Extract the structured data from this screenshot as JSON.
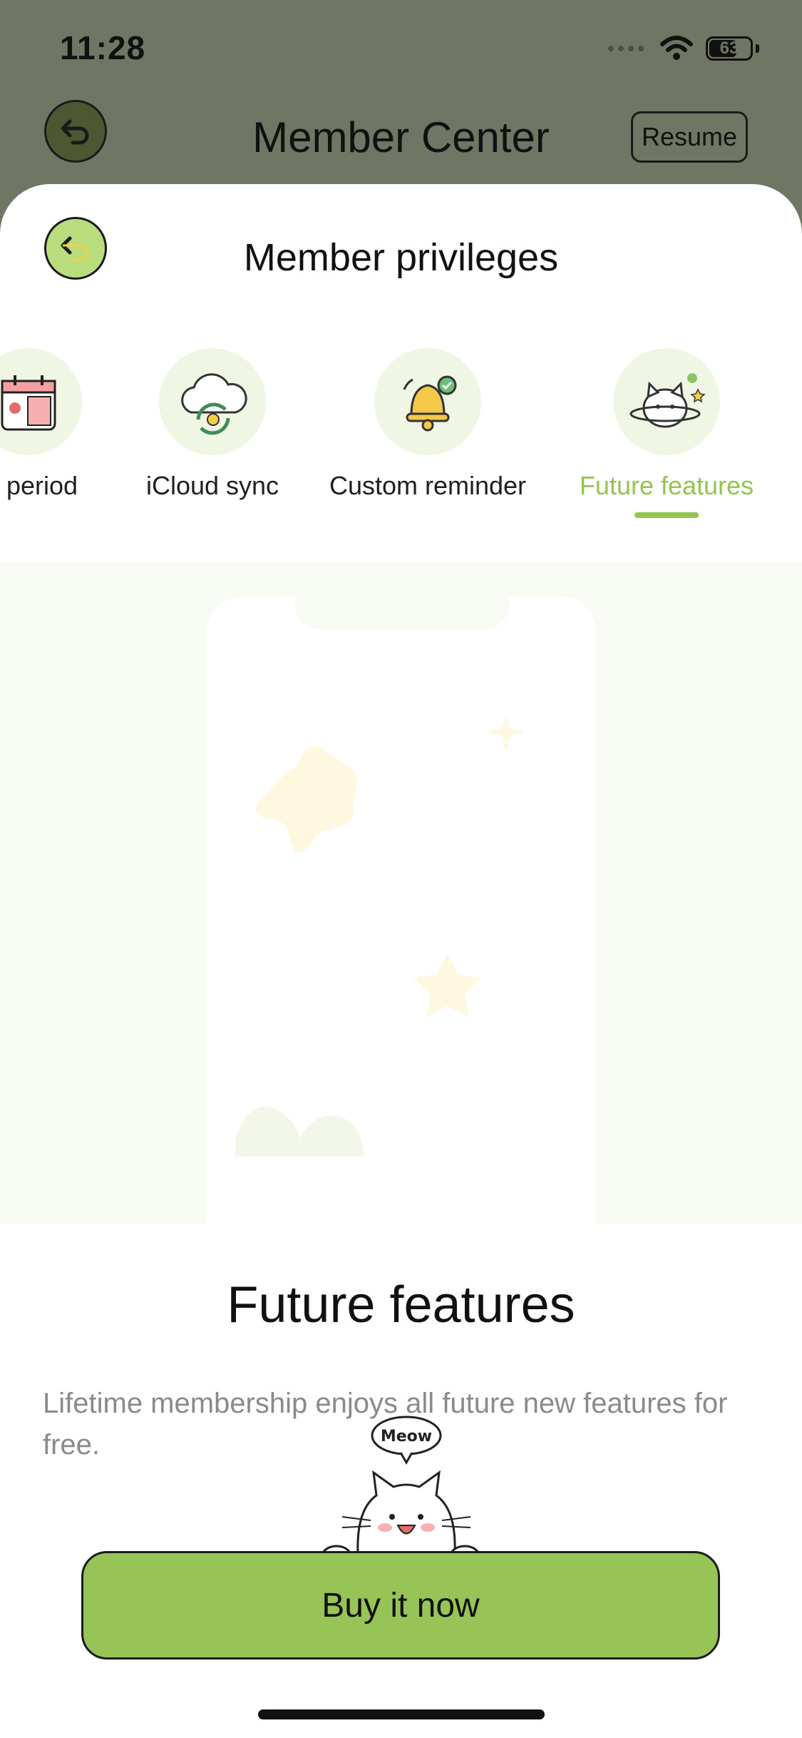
{
  "status_bar": {
    "time": "11:28",
    "battery": "63",
    "battery_level": 0.63
  },
  "header": {
    "title": "Member Center",
    "resume_label": "Resume"
  },
  "sheet": {
    "title": "Member privileges",
    "tabs": [
      {
        "label": "al period",
        "icon": "calendar-icon"
      },
      {
        "label": "iCloud sync",
        "icon": "cloud-sync-icon"
      },
      {
        "label": "Custom reminder",
        "icon": "bell-icon"
      },
      {
        "label": "Future features",
        "icon": "cat-planet-icon",
        "active": true
      }
    ]
  },
  "feature": {
    "title": "Future features",
    "description": "Lifetime membership enjoys all future new features for free."
  },
  "mascot": {
    "speech": "Meow"
  },
  "buy_button": {
    "label": "Buy it now"
  },
  "colors": {
    "accent": "#95c44f",
    "button": "#97c456",
    "backdrop": "#6f7764",
    "icon_bg": "#eff7e4"
  }
}
